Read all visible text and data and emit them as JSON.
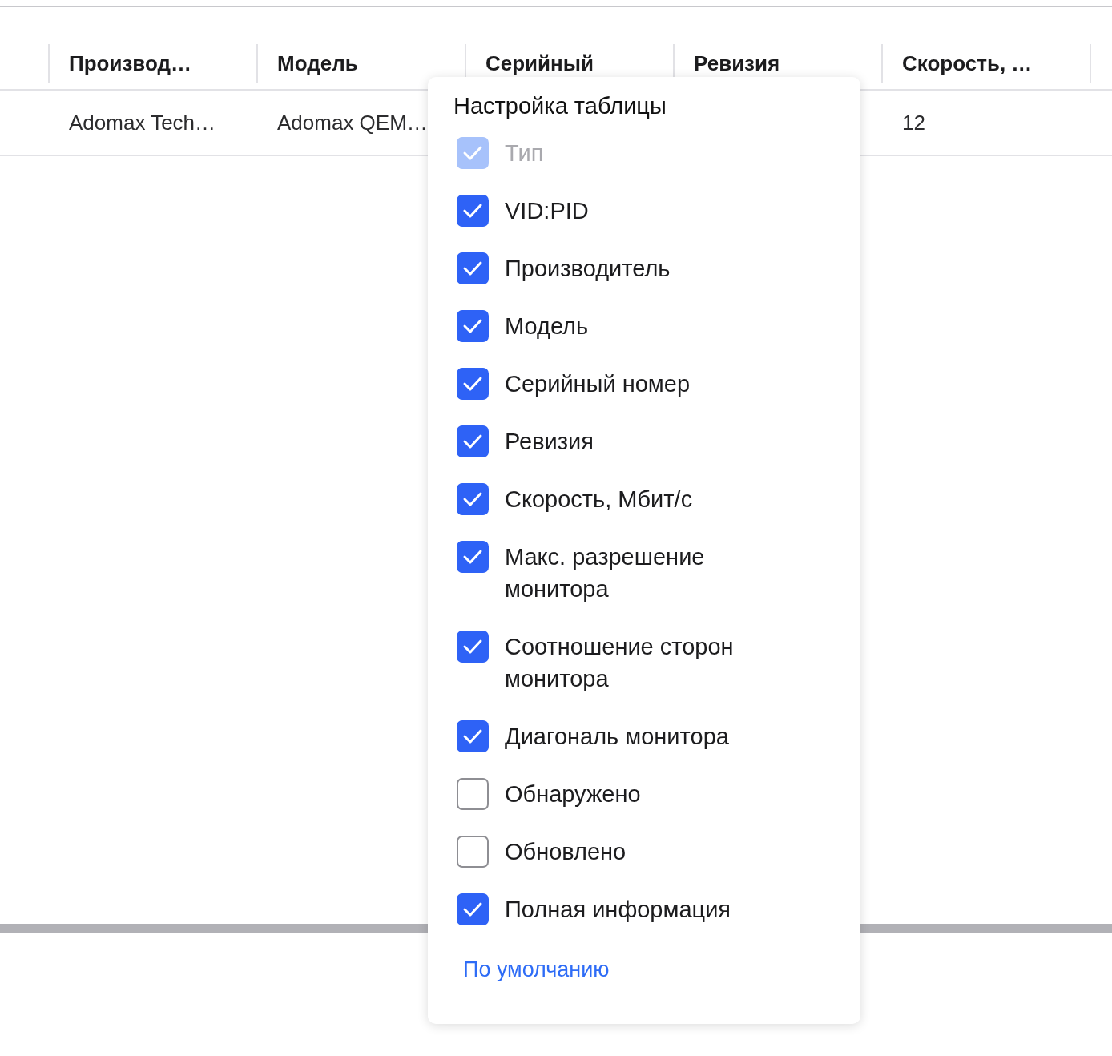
{
  "table": {
    "columns": [
      "Производ…",
      "Модель",
      "Серийный",
      "Ревизия",
      "Скорость, …"
    ],
    "rows": [
      {
        "cells": [
          "Adomax Tech…",
          "Adomax QEM…",
          null,
          null,
          "12"
        ]
      }
    ]
  },
  "popup": {
    "title": "Настройка таблицы",
    "items": [
      {
        "label": "Тип",
        "checked": true,
        "disabled": true
      },
      {
        "label": "VID:PID",
        "checked": true,
        "disabled": false
      },
      {
        "label": "Производитель",
        "checked": true,
        "disabled": false
      },
      {
        "label": "Модель",
        "checked": true,
        "disabled": false
      },
      {
        "label": "Серийный номер",
        "checked": true,
        "disabled": false
      },
      {
        "label": "Ревизия",
        "checked": true,
        "disabled": false
      },
      {
        "label": "Скорость, Мбит/с",
        "checked": true,
        "disabled": false
      },
      {
        "label": "Макс. разрешение монитора",
        "checked": true,
        "disabled": false
      },
      {
        "label": "Соотношение сторон монитора",
        "checked": true,
        "disabled": false
      },
      {
        "label": "Диагональ монитора",
        "checked": true,
        "disabled": false
      },
      {
        "label": "Обнаружено",
        "checked": false,
        "disabled": false
      },
      {
        "label": "Обновлено",
        "checked": false,
        "disabled": false
      },
      {
        "label": "Полная информация",
        "checked": true,
        "disabled": false
      }
    ],
    "reset_link": "По умолчанию"
  }
}
